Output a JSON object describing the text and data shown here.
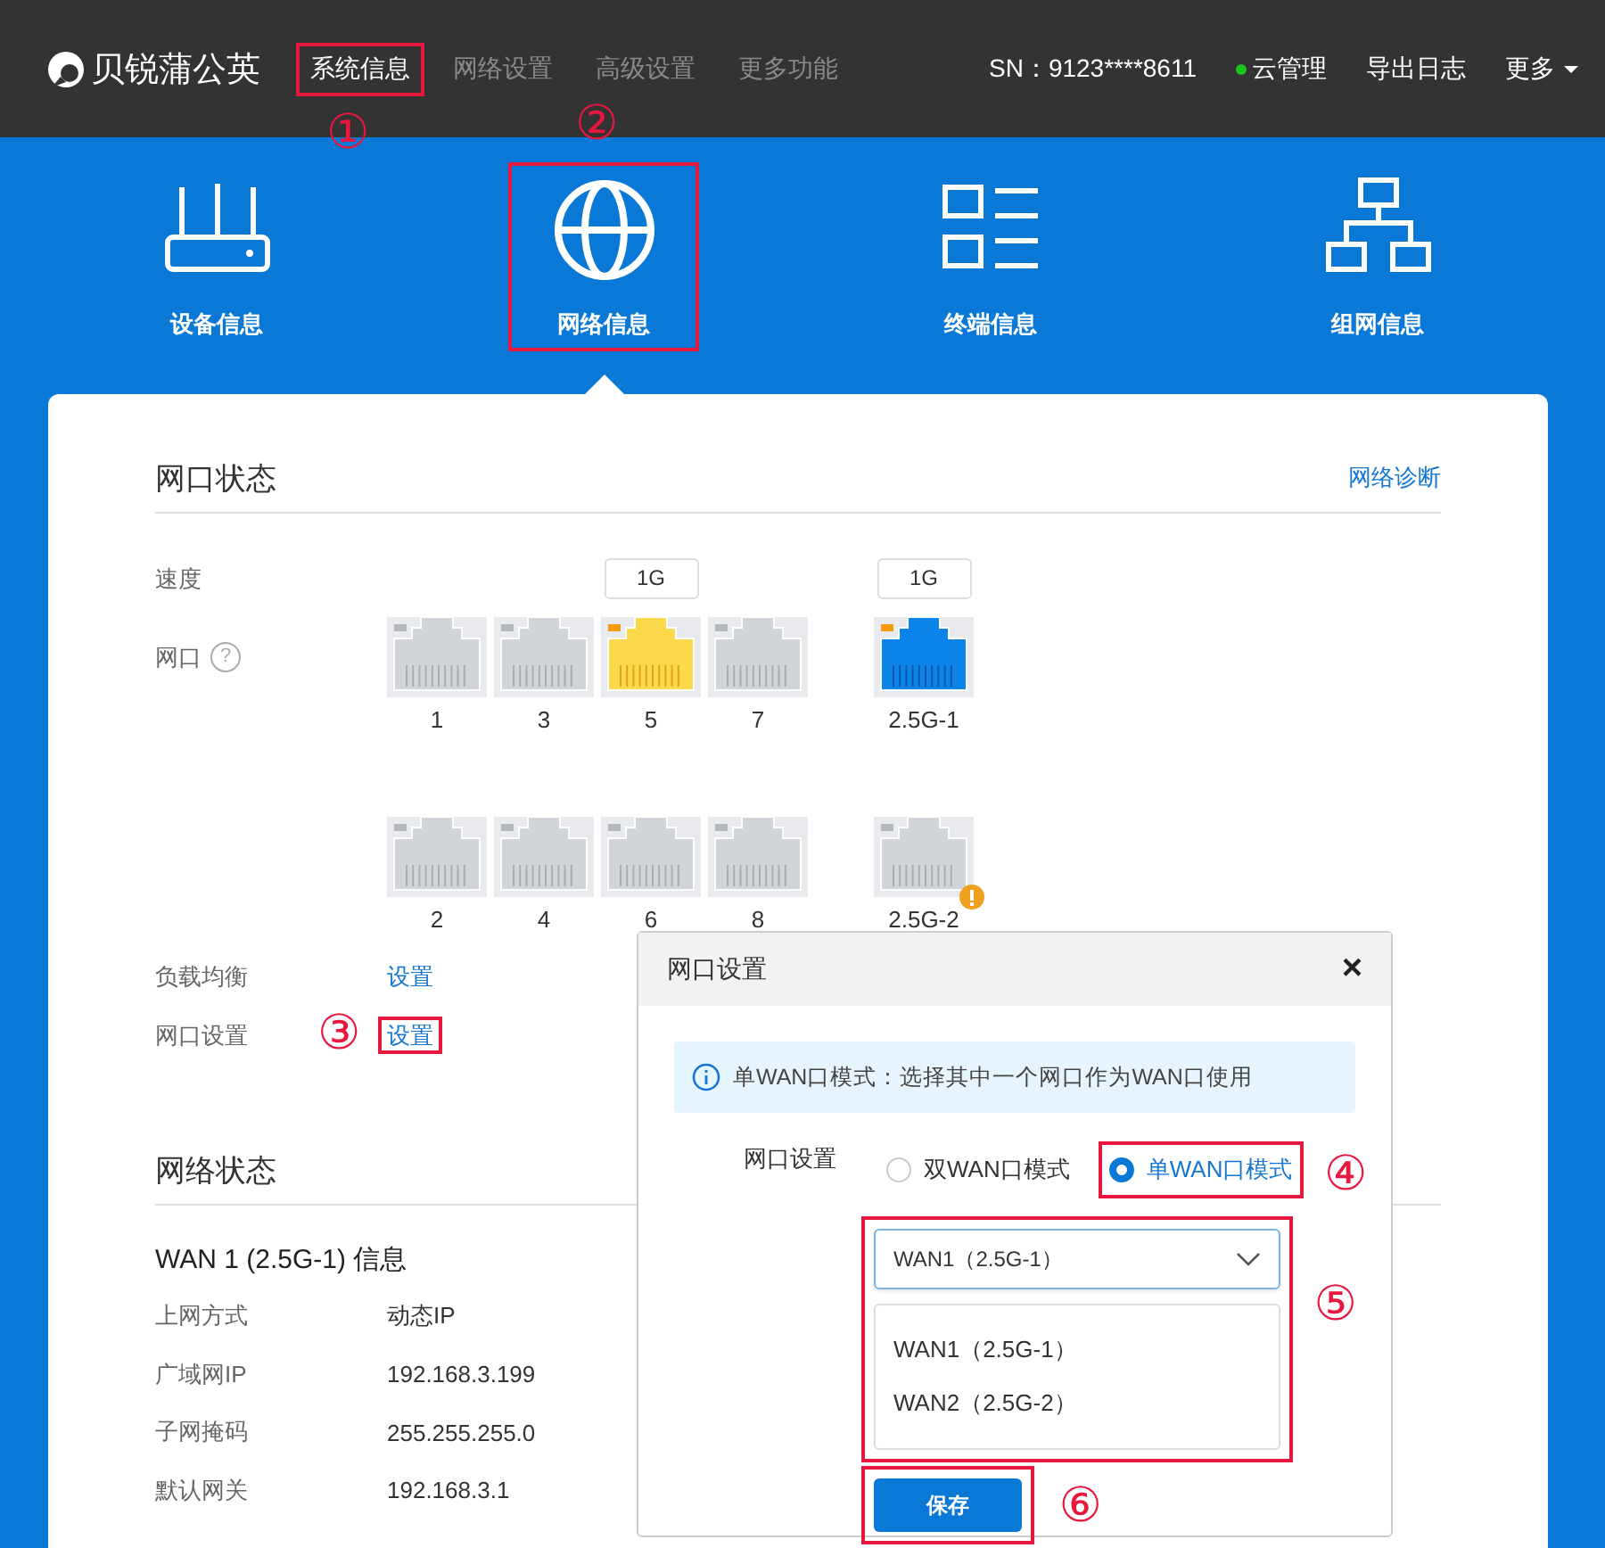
{
  "topbar": {
    "logo": "贝锐蒲公英",
    "nav": [
      {
        "label": "系统信息",
        "selected": true,
        "highlighted": true,
        "marker": "①"
      },
      {
        "label": "网络设置",
        "selected": false,
        "highlighted": false
      },
      {
        "label": "高级设置",
        "selected": false,
        "highlighted": false
      },
      {
        "label": "更多功能",
        "selected": false,
        "highlighted": false
      }
    ],
    "sn": "SN：9123****8611",
    "cloud": {
      "label": "云管理",
      "online": true
    },
    "export": "导出日志",
    "more": "更多"
  },
  "sections": [
    {
      "label": "设备信息",
      "kind": "router",
      "selected": false,
      "highlighted": false
    },
    {
      "label": "网络信息",
      "kind": "globe",
      "selected": true,
      "highlighted": true,
      "marker": "②"
    },
    {
      "label": "终端信息",
      "kind": "list",
      "selected": false,
      "highlighted": false
    },
    {
      "label": "组网信息",
      "kind": "tree",
      "selected": false,
      "highlighted": false
    }
  ],
  "port_status": {
    "title": "网口状态",
    "link": "网络诊断",
    "speed_label": "速度",
    "port_label": "网口",
    "help": "?",
    "port_rows": [
      [
        {
          "label": "1",
          "kind": "idle",
          "warning": false
        },
        {
          "label": "3",
          "kind": "idle",
          "warning": false
        },
        {
          "label": "5",
          "kind": "lan",
          "speed": "1G",
          "warning": false
        },
        {
          "label": "7",
          "kind": "idle",
          "warning": false
        },
        {
          "label": "2.5G-1",
          "kind": "wan",
          "speed": "1G",
          "warning": false
        }
      ],
      [
        {
          "label": "2",
          "kind": "idle",
          "warning": false
        },
        {
          "label": "4",
          "kind": "idle",
          "warning": false
        },
        {
          "label": "6",
          "kind": "idle",
          "warning": false
        },
        {
          "label": "8",
          "kind": "idle",
          "warning": false
        },
        {
          "label": "2.5G-2",
          "kind": "idle",
          "warning": true
        }
      ]
    ],
    "settings": [
      {
        "label": "负载均衡",
        "link": "设置",
        "highlighted": false
      },
      {
        "label": "网口设置",
        "link": "设置",
        "highlighted": true,
        "marker": "③"
      }
    ]
  },
  "network_status": {
    "title": "网络状态",
    "wan_title": "WAN 1 (2.5G-1)  信息",
    "rows": [
      {
        "label": "上网方式",
        "value": "动态IP"
      },
      {
        "label": "广域网IP",
        "value": "192.168.3.199"
      },
      {
        "label": "子网掩码",
        "value": "255.255.255.0"
      },
      {
        "label": "默认网关",
        "value": "192.168.3.1"
      }
    ]
  },
  "modal": {
    "title": "网口设置",
    "close": "×",
    "info": "单WAN口模式：选择其中一个网口作为WAN口使用",
    "field_label": "网口设置",
    "modes": [
      {
        "label": "双WAN口模式",
        "selected": false,
        "highlighted": false
      },
      {
        "label": "单WAN口模式",
        "selected": true,
        "highlighted": true,
        "marker": "④"
      }
    ],
    "select": {
      "value": "WAN1（2.5G-1）",
      "expanded": true,
      "highlighted": true,
      "marker": "⑤",
      "options": [
        "WAN1（2.5G-1）",
        "WAN2（2.5G-2）"
      ]
    },
    "save": {
      "label": "保存",
      "highlighted": true,
      "marker": "⑥"
    }
  }
}
